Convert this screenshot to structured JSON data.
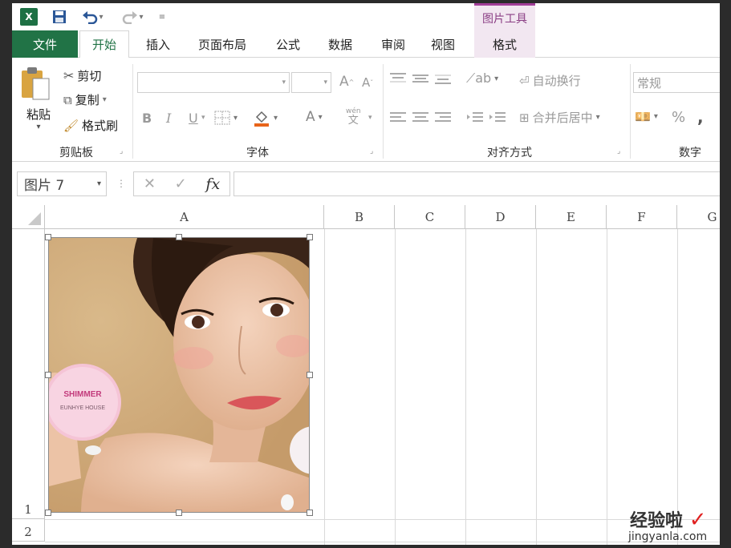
{
  "contextual_tab_header": "图片工具",
  "tabs": [
    "文件",
    "开始",
    "插入",
    "页面布局",
    "公式",
    "数据",
    "审阅",
    "视图",
    "格式"
  ],
  "clipboard": {
    "paste": "粘贴",
    "cut": "剪切",
    "copy": "复制",
    "format_painter": "格式刷",
    "label": "剪贴板"
  },
  "font": {
    "bold": "B",
    "italic": "I",
    "underline": "U",
    "increase": "A",
    "decrease": "A",
    "font_color": "A",
    "phonetic_top": "wén",
    "phonetic_bottom": "文",
    "label": "字体"
  },
  "alignment": {
    "wrap_text": "自动换行",
    "merge_center": "合并后居中",
    "label": "对齐方式"
  },
  "number": {
    "format": "常规",
    "percent": "%",
    "comma": ",",
    "label": "数字"
  },
  "formula_bar": {
    "name_box": "图片 7",
    "cancel": "✕",
    "enter": "✓",
    "fx": "fx",
    "value": ""
  },
  "columns": [
    "A",
    "B",
    "C",
    "D",
    "E",
    "F",
    "G"
  ],
  "rows": [
    "1",
    "2"
  ],
  "watermark": {
    "title": "经验啦",
    "check": "✓",
    "url": "jingyanla.com"
  },
  "colors": {
    "excel_green": "#217346",
    "context_purple": "#a23e98",
    "context_bg": "#f2e7f1"
  }
}
